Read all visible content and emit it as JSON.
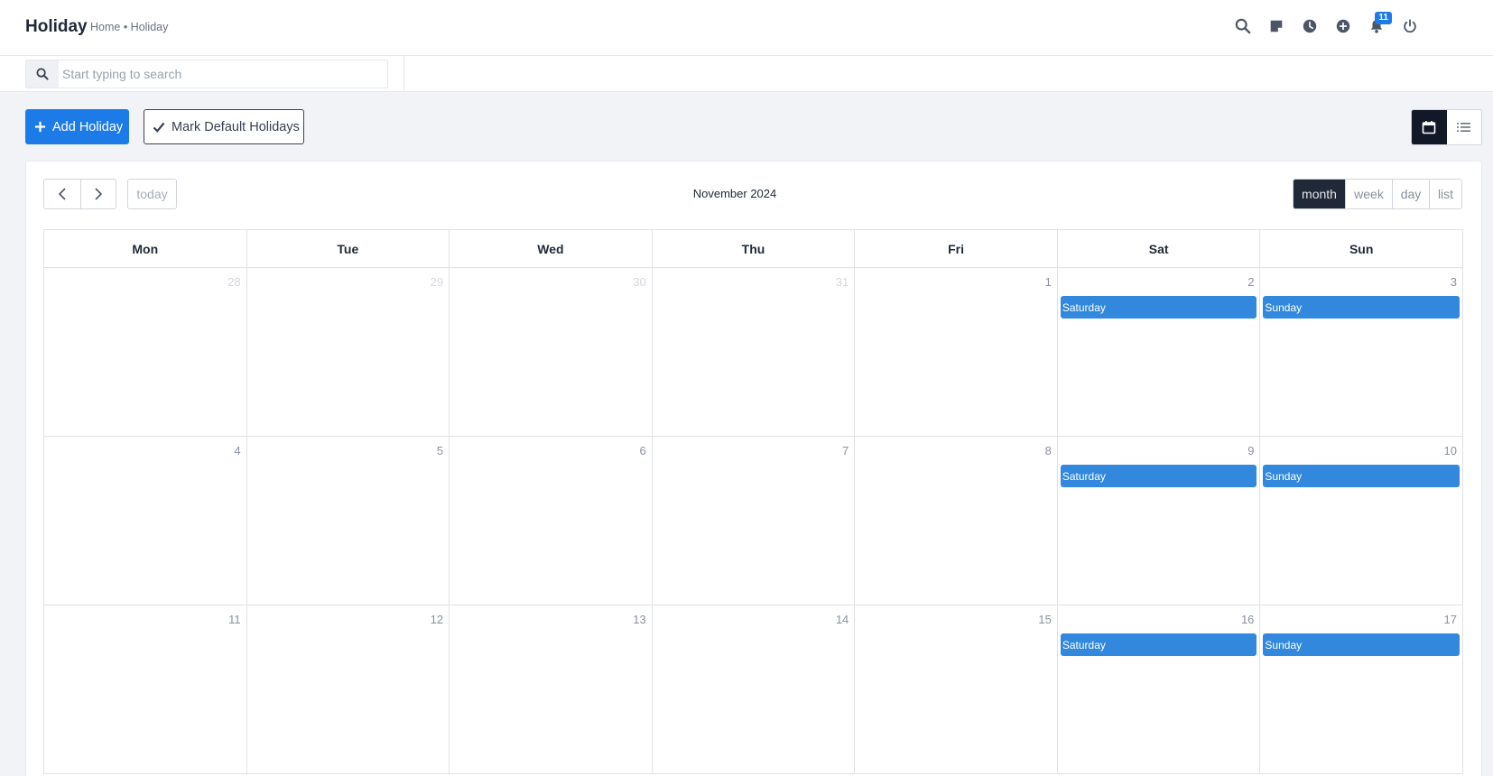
{
  "header": {
    "title": "Holiday",
    "breadcrumb": "Home • Holiday",
    "icons": [
      "search-icon",
      "sticky-note-icon",
      "clock-icon",
      "plus-circle-icon",
      "bell-icon",
      "power-icon"
    ],
    "notification_count": "11"
  },
  "search": {
    "placeholder": "Start typing to search"
  },
  "toolbar": {
    "add_label": "Add Holiday",
    "mark_label": "Mark Default Holidays"
  },
  "view_toggle": {
    "active": "calendar",
    "options": [
      "calendar-icon",
      "list-icon"
    ]
  },
  "calendar": {
    "title": "November 2024",
    "today_label": "today",
    "ranges": [
      "month",
      "week",
      "day",
      "list"
    ],
    "active_range": "month",
    "weekdays": [
      "Mon",
      "Tue",
      "Wed",
      "Thu",
      "Fri",
      "Sat",
      "Sun"
    ],
    "weeks": [
      [
        {
          "day": "28",
          "other": true
        },
        {
          "day": "29",
          "other": true
        },
        {
          "day": "30",
          "other": true
        },
        {
          "day": "31",
          "other": true
        },
        {
          "day": "1"
        },
        {
          "day": "2",
          "event": "Saturday"
        },
        {
          "day": "3",
          "event": "Sunday"
        }
      ],
      [
        {
          "day": "4"
        },
        {
          "day": "5"
        },
        {
          "day": "6"
        },
        {
          "day": "7"
        },
        {
          "day": "8"
        },
        {
          "day": "9",
          "event": "Saturday"
        },
        {
          "day": "10",
          "event": "Sunday"
        }
      ],
      [
        {
          "day": "11"
        },
        {
          "day": "12"
        },
        {
          "day": "13"
        },
        {
          "day": "14"
        },
        {
          "day": "15"
        },
        {
          "day": "16",
          "event": "Saturday"
        },
        {
          "day": "17",
          "event": "Sunday"
        }
      ]
    ]
  },
  "colors": {
    "accent": "#1d7be8",
    "event": "#3188dc",
    "active_dark": "#1f2937"
  }
}
